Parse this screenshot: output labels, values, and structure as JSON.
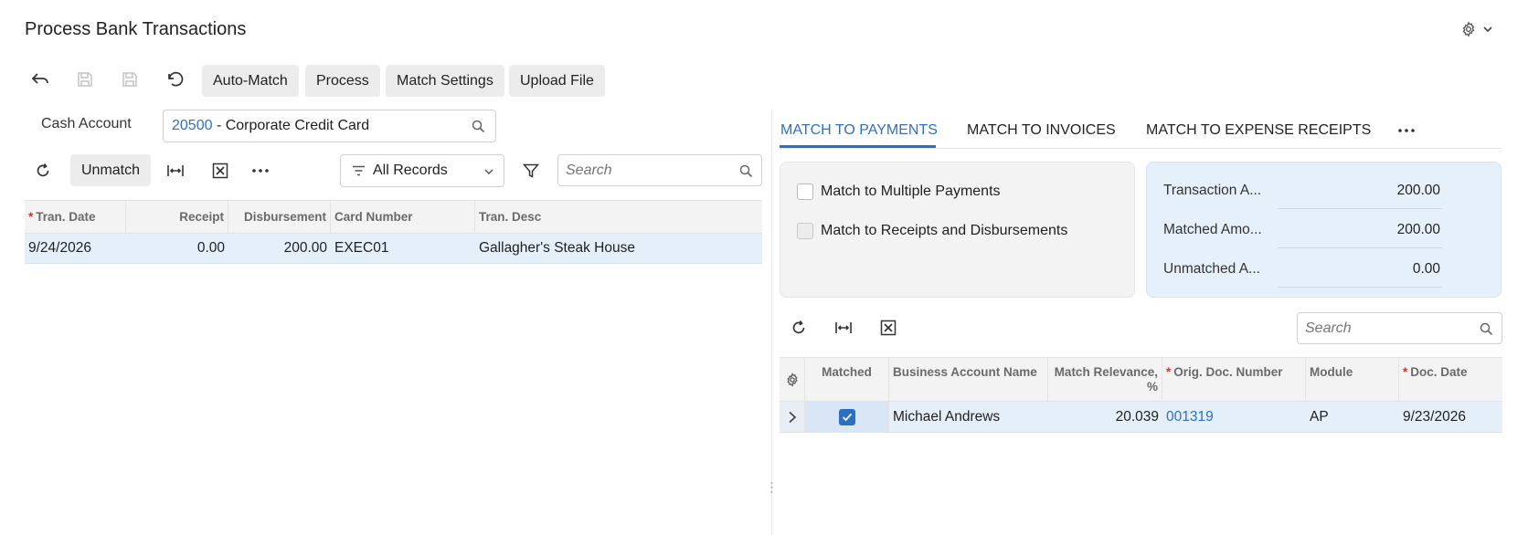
{
  "page": {
    "title": "Process Bank Transactions"
  },
  "icons": {
    "settings": "gear-icon",
    "chevron": "chevron-down-icon",
    "undo_back": "arrow-back-icon",
    "save": "save-icon",
    "save_close": "save-icon",
    "revert": "undo-icon",
    "refresh": "refresh-icon",
    "fit_columns": "fit-columns-icon",
    "export_excel": "excel-icon",
    "more": "more-icon",
    "filter": "filter-icon",
    "search": "search-icon",
    "expand": "chevron-right-icon",
    "check": "check-icon"
  },
  "colors": {
    "accent": "#2f6fc0",
    "row_selected": "#e5eff9",
    "summary_panel": "#e6f0fa",
    "required": "#d0342c"
  },
  "toolbar": {
    "auto_match": "Auto-Match",
    "process": "Process",
    "match_settings": "Match Settings",
    "upload_file": "Upload File"
  },
  "cash_account": {
    "label": "Cash Account",
    "code": "20500",
    "name": " - Corporate Credit Card"
  },
  "left_toolbar": {
    "unmatch": "Unmatch",
    "filter_value": "All Records",
    "search_placeholder": "Search"
  },
  "left_grid": {
    "columns": [
      "Tran. Date",
      "Receipt",
      "Disbursement",
      "Card Number",
      "Tran. Desc"
    ],
    "rows": [
      {
        "tran_date": "9/24/2026",
        "receipt": "0.00",
        "disbursement": "200.00",
        "card_number": "EXEC01",
        "tran_desc": "Gallagher's Steak House"
      }
    ]
  },
  "tabs": {
    "match_payments": "MATCH TO PAYMENTS",
    "match_invoices": "MATCH TO INVOICES",
    "match_expense": "MATCH TO EXPENSE RECEIPTS"
  },
  "options": {
    "multiple_payments": "Match to Multiple Payments",
    "receipts_disbursements": "Match to Receipts and Disbursements"
  },
  "summary": {
    "transaction_label": "Transaction A...",
    "transaction_value": "200.00",
    "matched_label": "Matched Amo...",
    "matched_value": "200.00",
    "unmatched_label": "Unmatched A...",
    "unmatched_value": "0.00"
  },
  "right_toolbar": {
    "search_placeholder": "Search"
  },
  "right_grid": {
    "columns": [
      "Matched",
      "Business Account Name",
      "Match Relevance,",
      "%",
      "Orig. Doc. Number",
      "Module",
      "Doc. Date"
    ],
    "rows": [
      {
        "matched": true,
        "business_account_name": "Michael Andrews",
        "match_relevance": "20.039",
        "orig_doc_number": "001319",
        "module": "AP",
        "doc_date": "9/23/2026"
      }
    ]
  }
}
